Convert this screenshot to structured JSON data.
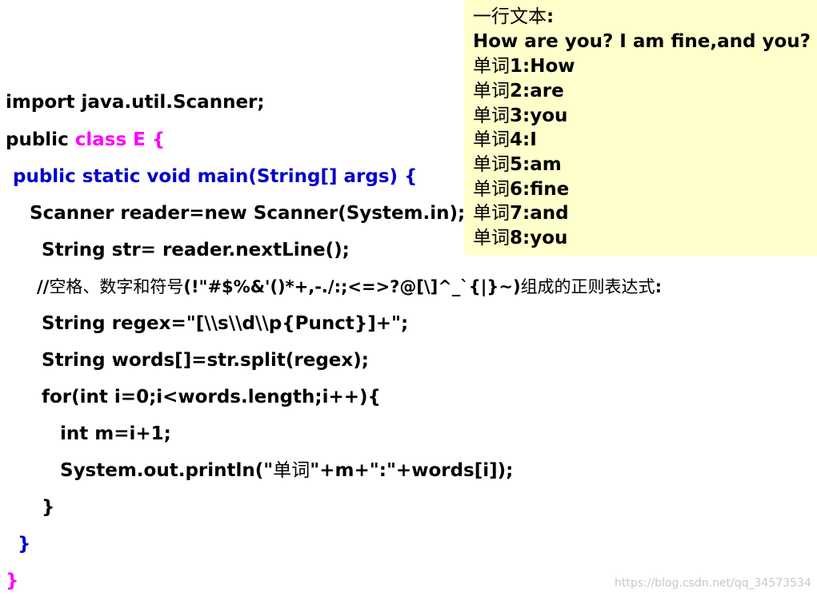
{
  "code": {
    "l1": "import java.util.Scanner;",
    "l2_a": "public ",
    "l2_b": "class E {",
    "l3": "public static void main(String[] args) {",
    "l4": "Scanner reader=new Scanner(System.in);",
    "l5": "String str= reader.nextLine();",
    "l6_a": "//",
    "l6_b": "空格、数字和符号",
    "l6_c": "(!\"#$%&'()*+,-./:;<=>?@[\\]^_`{|}~)",
    "l6_d": "组成的正则表达式",
    "l6_e": ":",
    "l7": "String regex=\"[\\\\s\\\\d\\\\p{Punct}]+\";",
    "l8": "String words[]=str.split(regex);",
    "l9": "for(int i=0;i<words.length;i++){",
    "l10": "int m=i+1;",
    "l11_a": "System.out.println(\"",
    "l11_b": "单词",
    "l11_c": "\"+m+\":\"+words[i]);",
    "l12": "}",
    "l13": "}",
    "l14": "}"
  },
  "output": {
    "header_label": "一行文本",
    "header_colon": ":",
    "input_line": "How are you? I am fine,and you?",
    "word_prefix": "单词",
    "words": [
      {
        "n": "1:How"
      },
      {
        "n": "2:are"
      },
      {
        "n": "3:you"
      },
      {
        "n": "4:I"
      },
      {
        "n": "5:am"
      },
      {
        "n": "6:fine"
      },
      {
        "n": "7:and"
      },
      {
        "n": "8:you"
      }
    ]
  },
  "colors": {
    "keyword": "#ff00ff",
    "method_line": "#0000cc",
    "output_background": "#ffffcc"
  },
  "watermark": "https://blog.csdn.net/qq_34573534"
}
